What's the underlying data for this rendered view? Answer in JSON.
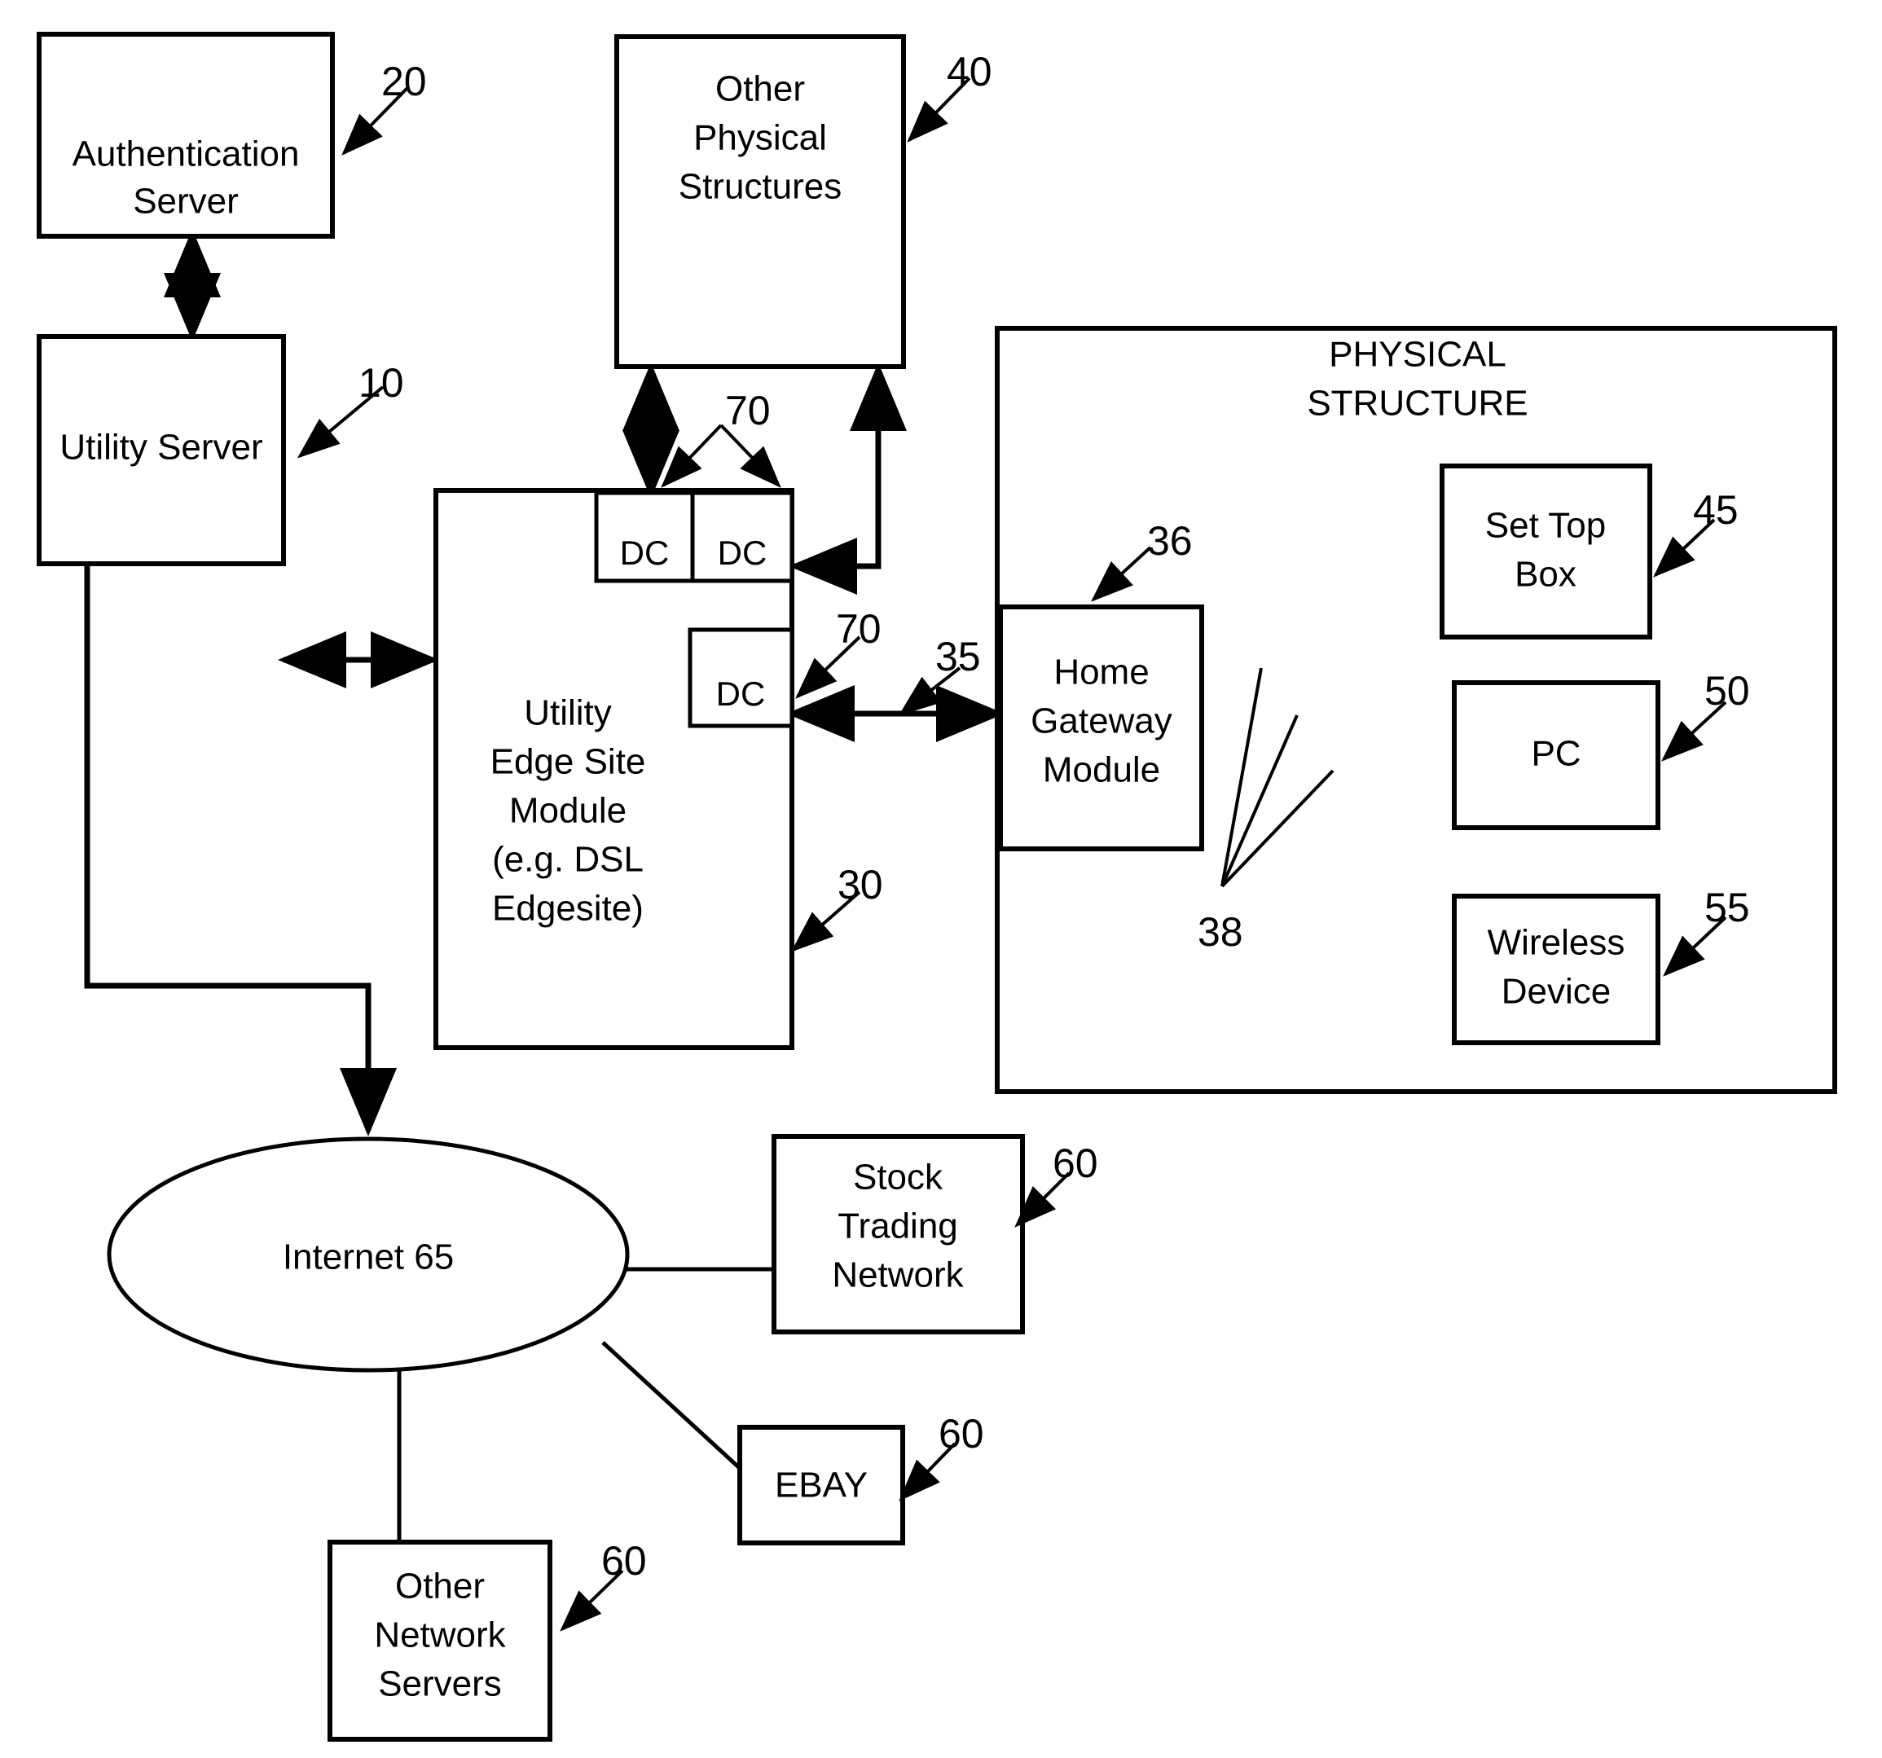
{
  "figure": {
    "type": "patent-block-diagram",
    "background": "#ffffff",
    "line_color": "#000000"
  },
  "nodes": {
    "authentication_server": {
      "label_line1": "Authentication",
      "label_line2": "Server",
      "ref": "20"
    },
    "utility_server": {
      "label_line1": "Utility Server",
      "ref": "10"
    },
    "other_physical_structures": {
      "label_line1": "Other",
      "label_line2": "Physical",
      "label_line3": "Structures",
      "ref": "40"
    },
    "utility_edge_site_module": {
      "label_line1": "Utility",
      "label_line2": "Edge Site",
      "label_line3": "Module",
      "label_line4": "(e.g. DSL",
      "label_line5": "Edgesite)",
      "ref": "30"
    },
    "dc_top_left": {
      "label": "DC",
      "ref": "70"
    },
    "dc_top_right": {
      "label": "DC",
      "ref": "70"
    },
    "dc_lower": {
      "label": "DC",
      "ref": "70"
    },
    "physical_structure": {
      "title_line1": "PHYSICAL",
      "title_line2": "STRUCTURE"
    },
    "home_gateway_module": {
      "label_line1": "Home",
      "label_line2": "Gateway",
      "label_line3": "Module",
      "ref": "36"
    },
    "set_top_box": {
      "label_line1": "Set Top",
      "label_line2": "Box",
      "ref": "45"
    },
    "pc": {
      "label_line1": "PC",
      "ref": "50"
    },
    "wireless_device": {
      "label_line1": "Wireless",
      "label_line2": "Device",
      "ref": "55"
    },
    "internet": {
      "label": "Internet   65",
      "ref": "65"
    },
    "stock_trading_network": {
      "label_line1": "Stock",
      "label_line2": "Trading",
      "label_line3": "Network",
      "ref": "60"
    },
    "ebay": {
      "label_line1": "EBAY",
      "ref": "60"
    },
    "other_network_servers": {
      "label_line1": "Other",
      "label_line2": "Network",
      "label_line3": "Servers",
      "ref": "60"
    }
  },
  "connection_refs": {
    "edge_to_gateway": "35",
    "gateway_to_devices": "38"
  },
  "reference_numerals": [
    "10",
    "20",
    "30",
    "35",
    "36",
    "38",
    "40",
    "45",
    "50",
    "55",
    "60",
    "65",
    "70"
  ]
}
